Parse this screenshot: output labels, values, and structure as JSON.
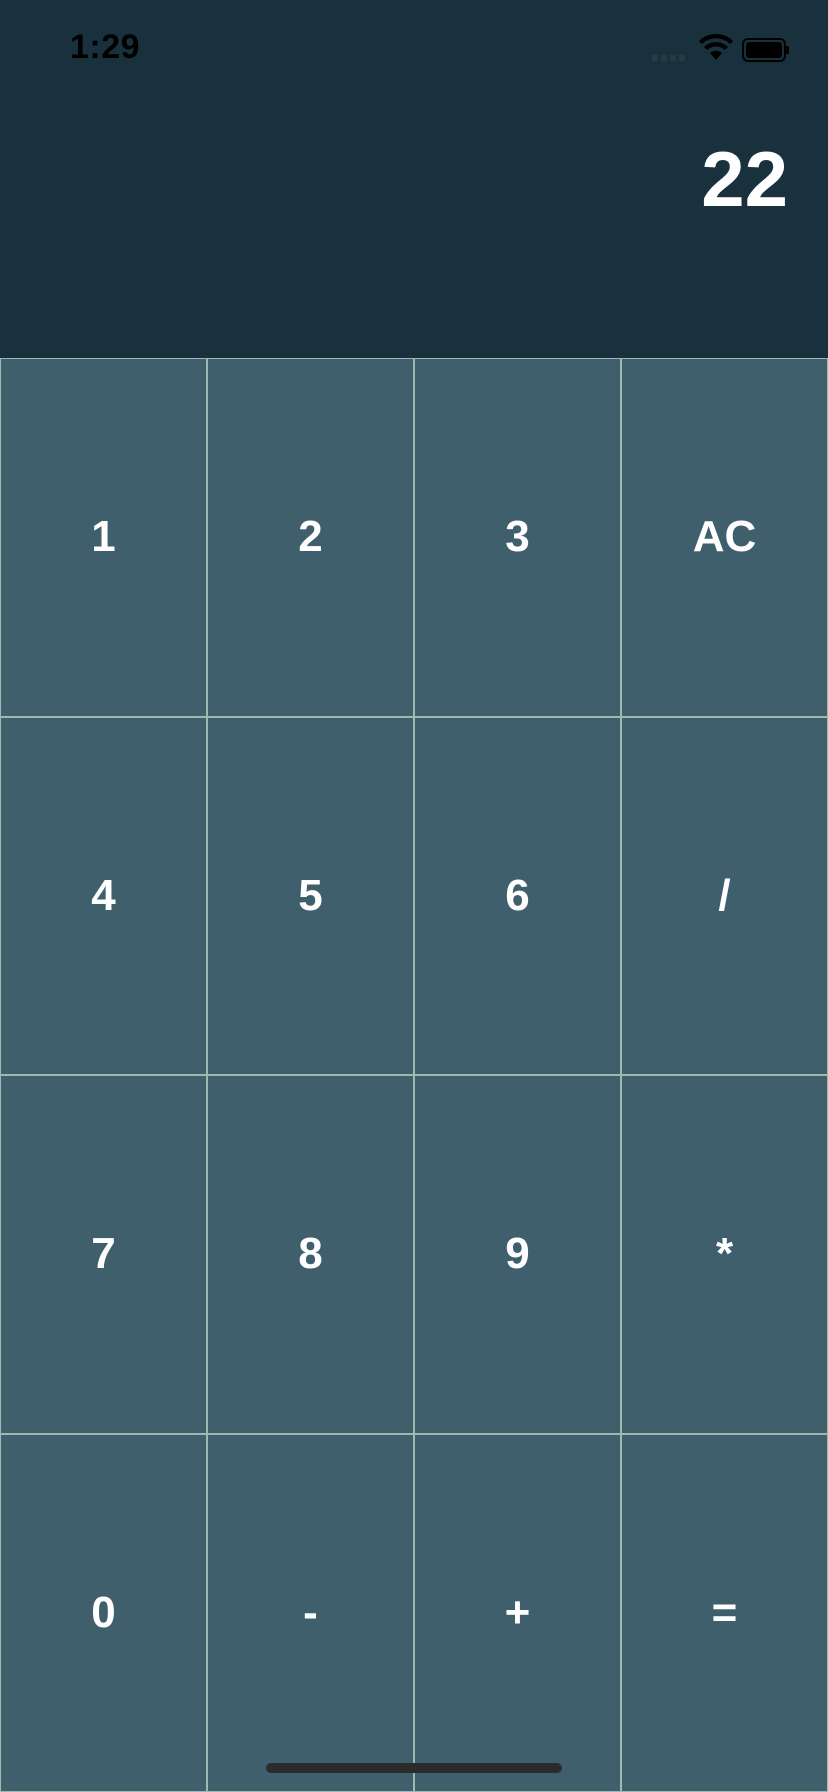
{
  "status_bar": {
    "time": "1:29",
    "icons": [
      "signal-bars-icon",
      "wifi-icon",
      "battery-icon"
    ]
  },
  "display": {
    "value": "22"
  },
  "keypad": {
    "keys": [
      "1",
      "2",
      "3",
      "AC",
      "4",
      "5",
      "6",
      "/",
      "7",
      "8",
      "9",
      "*",
      "0",
      "-",
      "+",
      "="
    ]
  },
  "colors": {
    "display_background": "#18313d",
    "key_background": "#3f5f6d",
    "key_border": "#9fb8b0",
    "text": "#ffffff"
  }
}
